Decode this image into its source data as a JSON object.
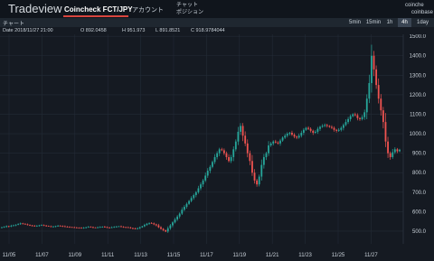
{
  "header": {
    "brand": "Tradeview",
    "market_tab": "Coincheck FCT/JPY",
    "account_tab": "アカウント",
    "chat_tab": "チャット",
    "position_tab": "ポジション",
    "external_1": "coinche",
    "external_2": "coinbase"
  },
  "toolbar": {
    "title": "チャート",
    "timeframes": [
      "5min",
      "15min",
      "1h",
      "4h",
      "1day"
    ],
    "active_timeframe": "4h"
  },
  "ohlc": {
    "date": "Date 2018/11/27 21:00",
    "open": "O 892.0458",
    "high": "H 951.973",
    "low": "L 891.8521",
    "close": "C 918.9784044"
  },
  "colors": {
    "background": "#151a22",
    "up": "#26a69a",
    "down": "#ef5350",
    "grid": "#232b36",
    "text": "#c9d1d9"
  },
  "chart_data": {
    "type": "candlestick",
    "x_labels": [
      "11/05",
      "11/07",
      "11/09",
      "11/11",
      "11/13",
      "11/15",
      "11/17",
      "11/19",
      "11/21",
      "11/23",
      "11/25",
      "11/27"
    ],
    "y_ticks": [
      "1500.0",
      "1400.0",
      "1300.0",
      "1200.0",
      "1100.0",
      "1000.0",
      "900.0",
      "800.0",
      "700.0",
      "600.0",
      "500.0"
    ],
    "ylim": [
      435,
      1510
    ],
    "close_series": [
      520,
      522,
      526,
      524,
      528,
      530,
      533,
      536,
      540,
      538,
      535,
      532,
      530,
      528,
      526,
      528,
      530,
      531,
      529,
      527,
      525,
      523,
      524,
      526,
      528,
      527,
      525,
      523,
      522,
      521,
      520,
      519,
      518,
      517,
      516,
      518,
      520,
      522,
      521,
      519,
      518,
      520,
      522,
      523,
      521,
      519,
      518,
      520,
      522,
      524,
      525,
      523,
      521,
      520,
      519,
      516,
      514,
      512,
      515,
      520,
      525,
      532,
      538,
      542,
      540,
      535,
      530,
      520,
      512,
      505,
      498,
      515,
      530,
      545,
      560,
      575,
      590,
      610,
      625,
      640,
      655,
      670,
      685,
      700,
      720,
      740,
      760,
      785,
      810,
      830,
      855,
      880,
      900,
      920,
      915,
      900,
      880,
      860,
      880,
      920,
      960,
      1010,
      1040,
      990,
      950,
      900,
      860,
      800,
      760,
      740,
      780,
      840,
      880,
      900,
      940,
      950,
      960,
      955,
      950,
      965,
      980,
      990,
      1000,
      1005,
      995,
      985,
      980,
      990,
      1005,
      1020,
      1030,
      1025,
      1015,
      1005,
      1010,
      1025,
      1035,
      1040,
      1045,
      1040,
      1035,
      1030,
      1020,
      1015,
      1020,
      1030,
      1045,
      1060,
      1075,
      1090,
      1100,
      1095,
      1080,
      1075,
      1085,
      1110,
      1180,
      1260,
      1400,
      1330,
      1250,
      1180,
      1120,
      1060,
      960,
      900,
      880,
      905,
      920,
      910,
      918
    ]
  }
}
